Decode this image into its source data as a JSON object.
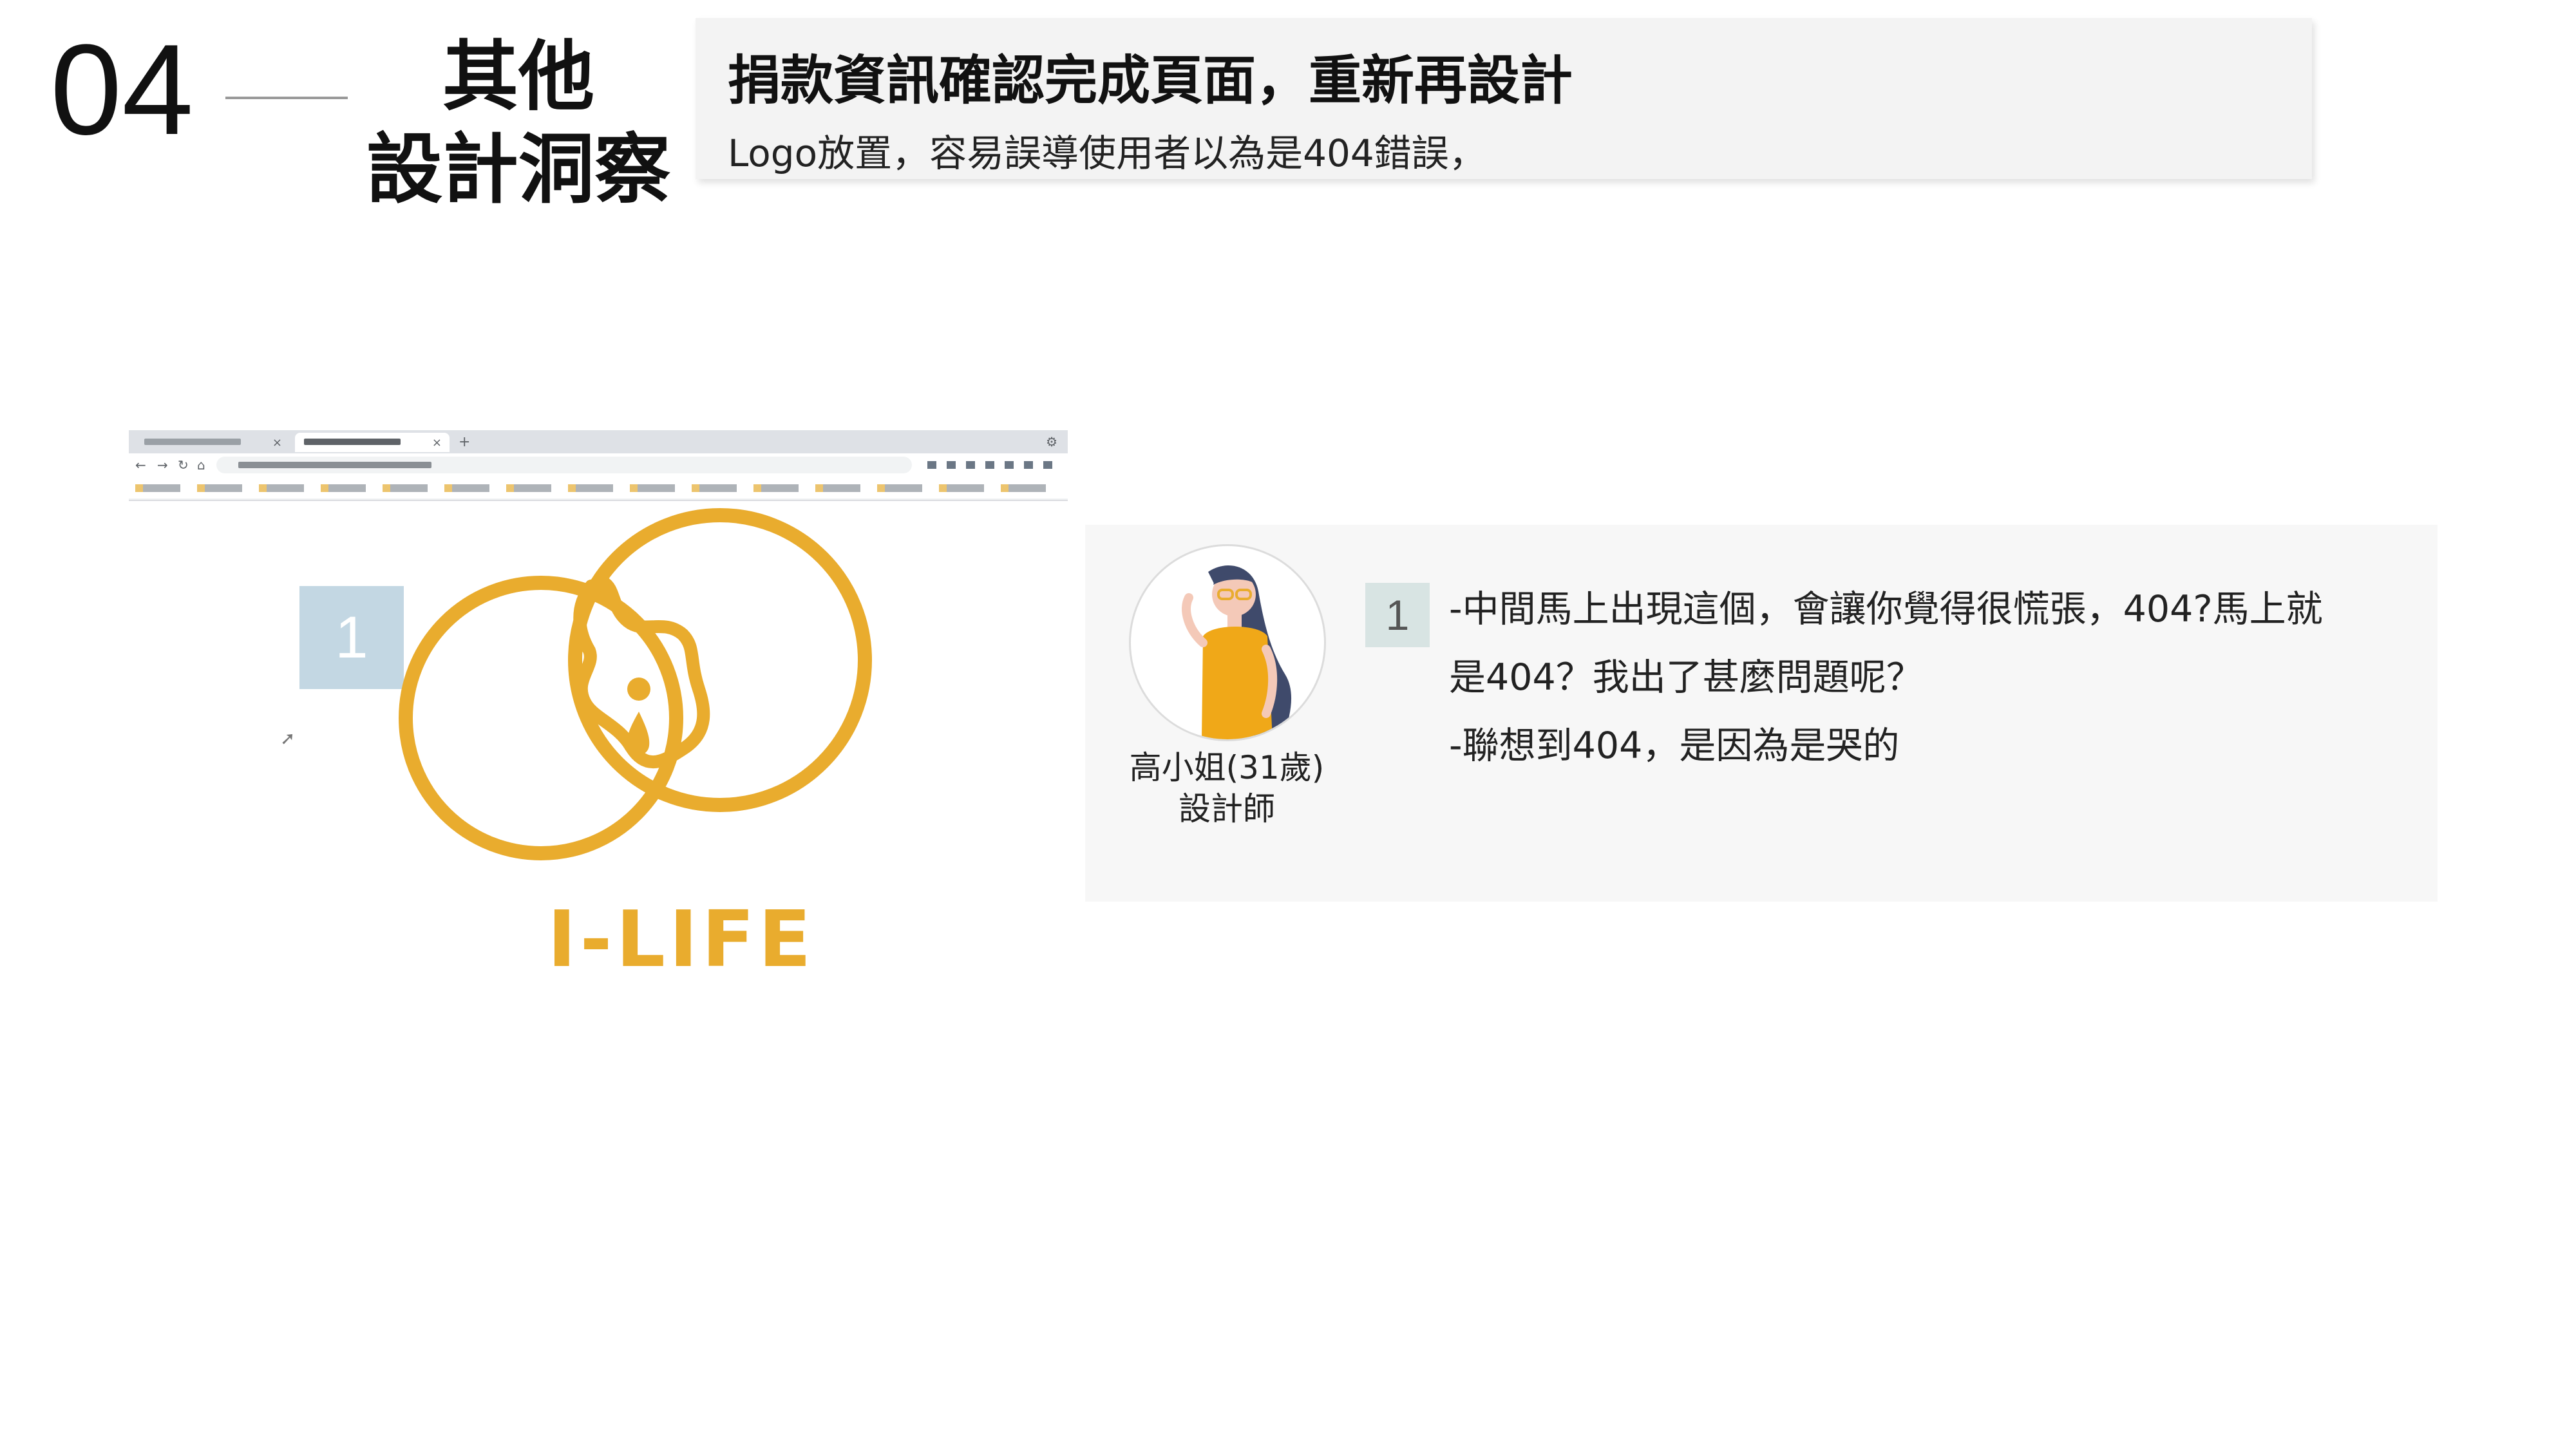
{
  "header": {
    "section_number": "04",
    "section_title_line1": "其他",
    "section_title_line2": "設計洞察",
    "title": "捐款資訊確認完成頁面，重新再設計",
    "description": "Logo放置，容易誤導使用者以為是404錯誤，"
  },
  "logo": {
    "wordmark": "I-LIFE",
    "marker": "1"
  },
  "persona": {
    "name": "高小姐(31歲)",
    "role": "設計師",
    "marker": "1",
    "quote_lines": [
      "-中間馬上出現這個，會讓你覺得很慌張，404?馬上就",
      "是404？我出了甚麼問題呢？",
      "-聯想到404，是因為是哭的"
    ]
  },
  "colors": {
    "logo_yellow": "#e9ac2e",
    "marker_blue": "#c3d7e3",
    "marker_green": "#d8e4e3",
    "card_bg": "#f7f7f7",
    "header_bg": "#f3f3f3"
  }
}
